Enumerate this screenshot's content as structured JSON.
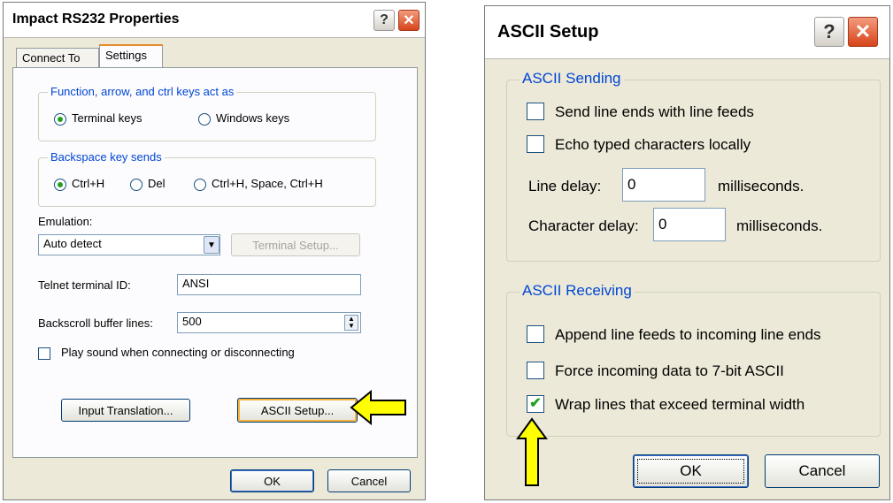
{
  "props_dialog": {
    "title": "Impact RS232 Properties",
    "help_glyph": "?",
    "close_glyph": "✕",
    "tabs": [
      "Connect To",
      "Settings"
    ],
    "active_tab": "Settings",
    "func_keys": {
      "legend": "Function, arrow, and ctrl keys act as",
      "terminal_keys": "Terminal keys",
      "windows_keys": "Windows keys",
      "selected": "Terminal keys"
    },
    "backspace": {
      "legend": "Backspace key sends",
      "option1": "Ctrl+H",
      "option2": "Del",
      "option3": "Ctrl+H, Space, Ctrl+H",
      "selected": "Ctrl+H"
    },
    "emulation_label": "Emulation:",
    "emulation_value": "Auto detect",
    "terminal_setup": "Terminal Setup...",
    "telnet_label": "Telnet terminal ID:",
    "telnet_value": "ANSI",
    "backscroll_label": "Backscroll buffer lines:",
    "backscroll_value": "500",
    "play_sound": "Play sound when connecting or disconnecting",
    "input_translation": "Input Translation...",
    "ascii_setup": "ASCII Setup...",
    "ok": "OK",
    "cancel": "Cancel"
  },
  "ascii_dialog": {
    "title": "ASCII Setup",
    "help_glyph": "?",
    "close_glyph": "✕",
    "sending": {
      "legend": "ASCII Sending",
      "send_line_ends": "Send line ends with line feeds",
      "echo": "Echo typed characters locally",
      "line_delay_label": "Line delay:",
      "line_delay_value": "0",
      "line_delay_unit": "milliseconds.",
      "char_delay_label": "Character delay:",
      "char_delay_value": "0",
      "char_delay_unit": "milliseconds."
    },
    "receiving": {
      "legend": "ASCII Receiving",
      "append": "Append line feeds to incoming line ends",
      "force": "Force incoming data to 7-bit ASCII",
      "wrap": "Wrap lines that exceed terminal width",
      "wrap_checked": true
    },
    "ok": "OK",
    "cancel": "Cancel"
  },
  "colors": {
    "dialog_bg": "#ece9d8",
    "accent_blue": "#0046d5",
    "arrow_fill": "#ffff00",
    "check_green": "#21a121"
  }
}
